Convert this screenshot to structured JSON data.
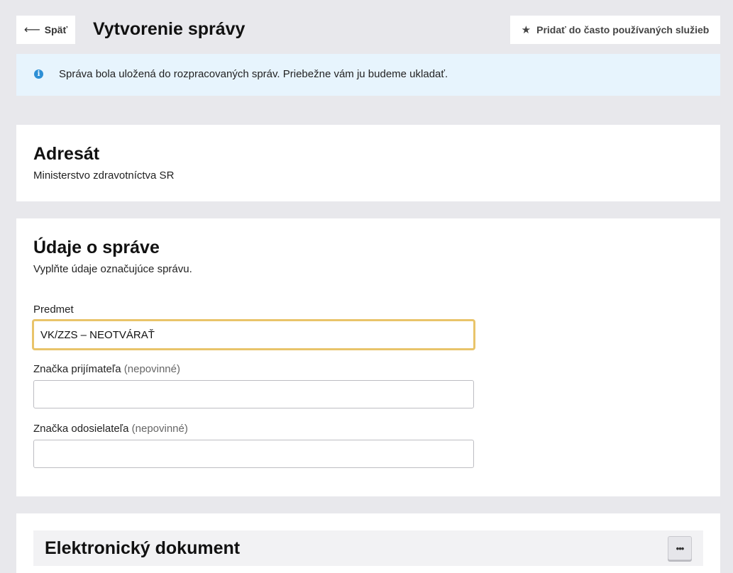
{
  "header": {
    "back_label": "Späť",
    "title": "Vytvorenie správy",
    "favorite_label": "Pridať do často používaných služieb"
  },
  "alert": {
    "icon": "info-icon",
    "text": "Správa bola uložená do rozpracovaných správ. Priebežne vám ju budeme ukladať."
  },
  "addressee": {
    "heading": "Adresát",
    "value": "Ministerstvo zdravotníctva SR"
  },
  "message": {
    "heading": "Údaje o správe",
    "subtitle": "Vyplňte údaje označujúce správu.",
    "subject": {
      "label": "Predmet",
      "value": "VK/ZZS – NEOTVÁRAŤ"
    },
    "recipient_ref": {
      "label": "Značka prijímateľa",
      "optional": "(nepovinné)",
      "value": ""
    },
    "sender_ref": {
      "label": "Značka odosielateľa",
      "optional": "(nepovinné)",
      "value": ""
    }
  },
  "document": {
    "heading": "Elektronický dokument",
    "more_label": "•••"
  },
  "colors": {
    "background": "#e8e8ec",
    "alert_bg": "#e7f4fd",
    "info_icon": "#2d8fd5",
    "focus_border": "#e9c46a"
  }
}
